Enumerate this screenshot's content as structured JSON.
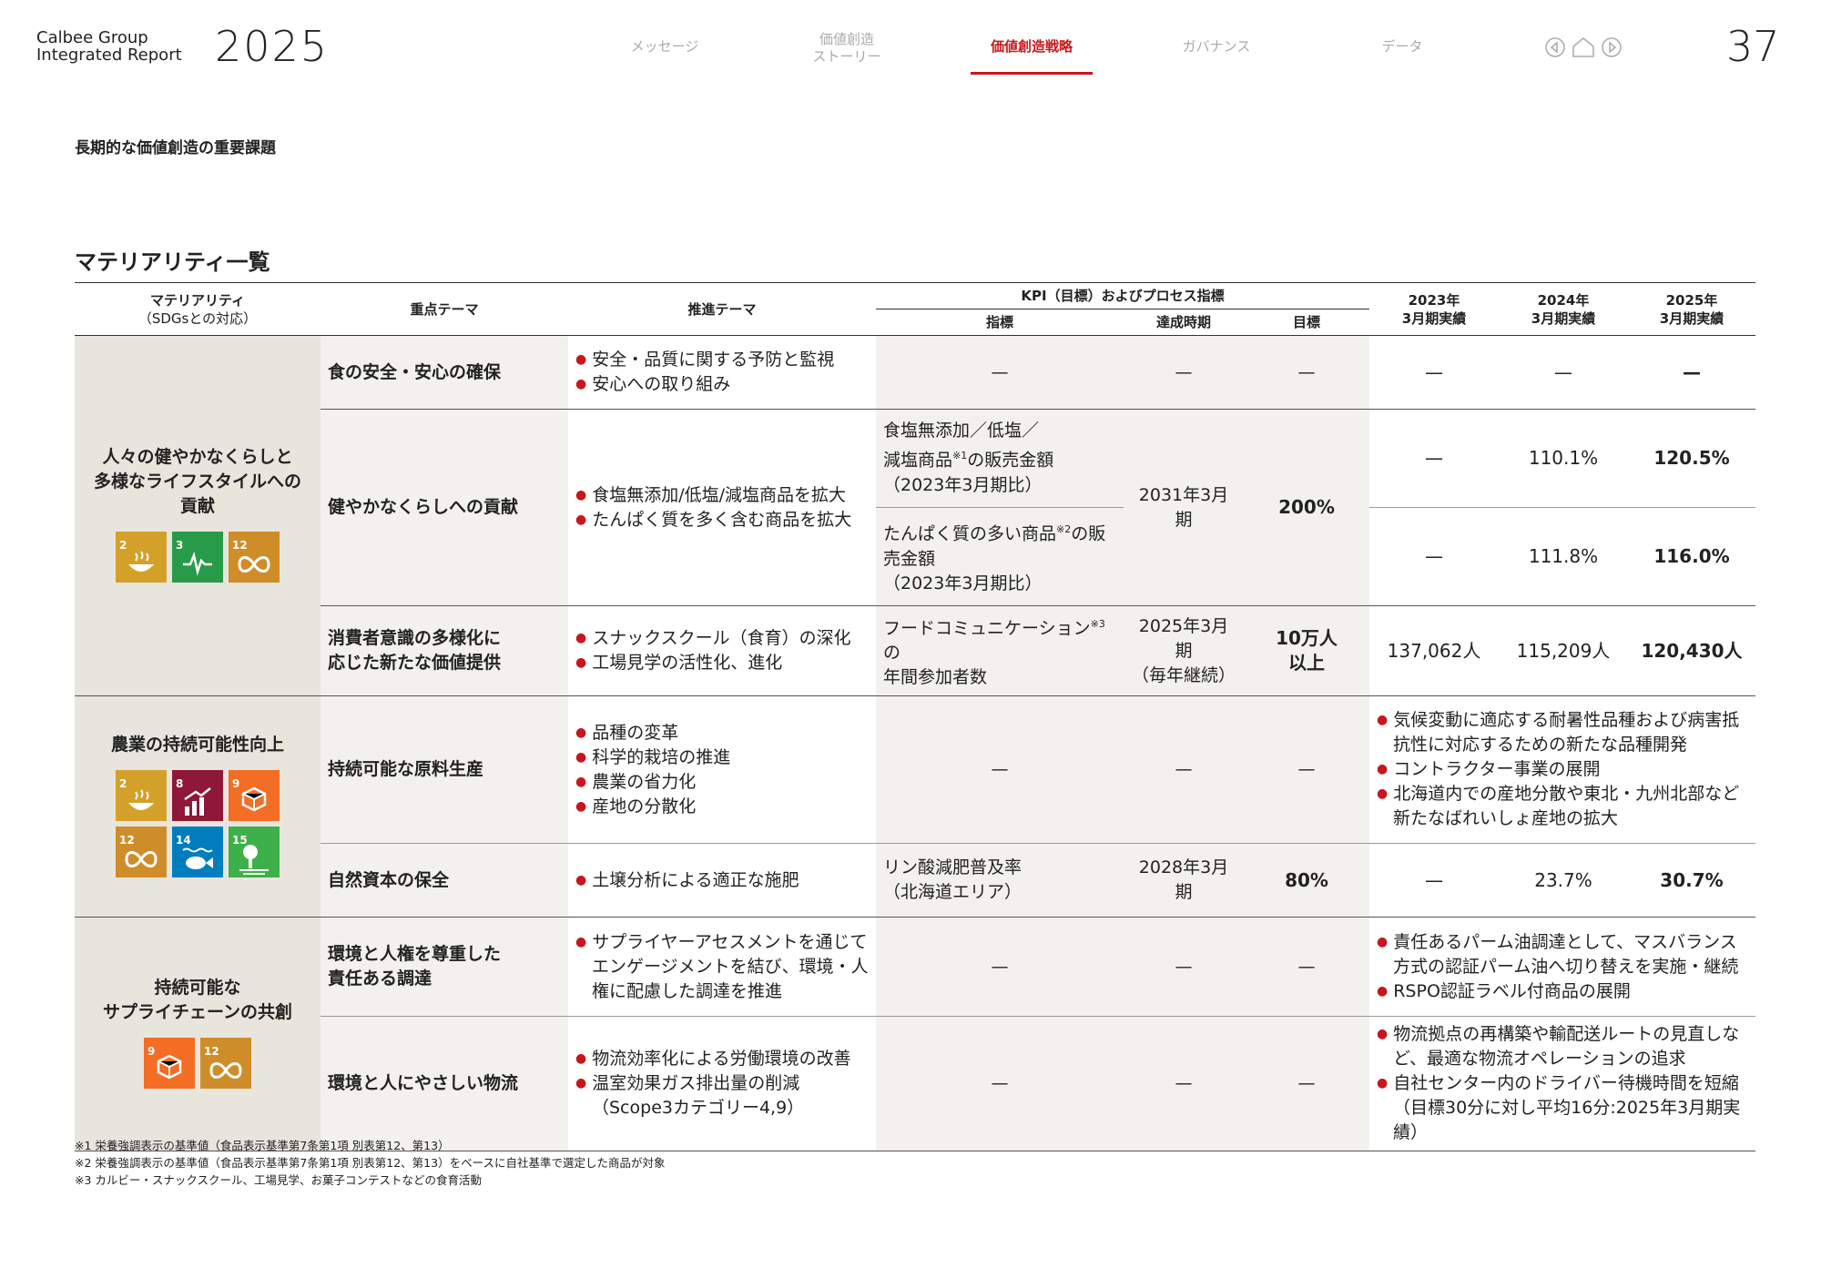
{
  "header": {
    "brand_line1": "Calbee Group",
    "brand_line2": "Integrated Report",
    "year": "2025",
    "page_number": "37",
    "nav": [
      {
        "label": "メッセージ"
      },
      {
        "label1": "価値創造",
        "label2": "ストーリー"
      },
      {
        "label": "価値創造戦略"
      },
      {
        "label": "ガバナンス"
      },
      {
        "label": "データ"
      }
    ],
    "accent_color": "#c8161d"
  },
  "section_title": "長期的な価値創造の重要課題",
  "table_title": "マテリアリティ一覧",
  "table": {
    "headers": {
      "materiality": "マテリアリティ",
      "materiality_sub": "（SDGsとの対応）",
      "focus_theme": "重点テーマ",
      "promotion_theme": "推進テーマ",
      "kpi_group": "KPI（目標）およびプロセス指標",
      "indicator": "指標",
      "deadline": "達成時期",
      "target": "目標",
      "fy2023_1": "2023年",
      "fy2023_2": "3月期実績",
      "fy2024_1": "2024年",
      "fy2024_2": "3月期実績",
      "fy2025_1": "2025年",
      "fy2025_2": "3月期実績"
    },
    "groups": [
      {
        "materiality_lines": [
          "人々の健やかなくらしと",
          "多様なライフスタイルへの",
          "貢献"
        ],
        "sdgs": [
          {
            "num": "2",
            "color": "#d3a029",
            "icon": "bowl-icon"
          },
          {
            "num": "3",
            "color": "#279b48",
            "icon": "heartbeat-icon"
          },
          {
            "num": "12",
            "color": "#cf8d2a",
            "icon": "infinity-icon"
          }
        ]
      },
      {
        "materiality_lines": [
          "農業の持続可能性向上"
        ],
        "sdgs": [
          {
            "num": "2",
            "color": "#d3a029",
            "icon": "bowl-icon"
          },
          {
            "num": "8",
            "color": "#8f1838",
            "icon": "growth-chart-icon"
          },
          {
            "num": "9",
            "color": "#f36d25",
            "icon": "cubes-icon"
          },
          {
            "num": "12",
            "color": "#cf8d2a",
            "icon": "infinity-icon"
          },
          {
            "num": "14",
            "color": "#007dbc",
            "icon": "fish-icon"
          },
          {
            "num": "15",
            "color": "#3eb049",
            "icon": "tree-icon"
          }
        ]
      },
      {
        "materiality_lines": [
          "持続可能な",
          "サプライチェーンの共創"
        ],
        "sdgs": [
          {
            "num": "9",
            "color": "#f36d25",
            "icon": "cubes-icon"
          },
          {
            "num": "12",
            "color": "#cf8d2a",
            "icon": "infinity-icon"
          }
        ]
      }
    ],
    "rows": {
      "r1": {
        "theme": "食の安全・安心の確保",
        "promo": [
          "安全・品質に関する予防と監視",
          "安心への取り組み"
        ],
        "indicator": "—",
        "deadline": "—",
        "target": "—",
        "fy2023": "—",
        "fy2024": "—",
        "fy2025": "—"
      },
      "r2": {
        "theme": "健やかなくらしへの貢献",
        "promo": [
          "食塩無添加/低塩/減塩商品を拡大",
          "たんぱく質を多く含む商品を拡大"
        ],
        "indicator_a_1": "食塩無添加／低塩／",
        "indicator_a_2": "減塩商品",
        "indicator_a_sup": "※1",
        "indicator_a_3": "の販売金額",
        "indicator_a_4": "（2023年3月期比）",
        "indicator_b_1": "たんぱく質の多い商品",
        "indicator_b_sup": "※2",
        "indicator_b_2": "の販",
        "indicator_b_3": "売金額",
        "indicator_b_4": "（2023年3月期比）",
        "deadline": "2031年3月期",
        "target": "200%",
        "a_fy2023": "—",
        "a_fy2024": "110.1%",
        "a_fy2025": "120.5%",
        "b_fy2023": "—",
        "b_fy2024": "111.8%",
        "b_fy2025": "116.0%"
      },
      "r3": {
        "theme_1": "消費者意識の多様化に",
        "theme_2": "応じた新たな価値提供",
        "promo": [
          "スナックスクール（食育）の深化",
          "工場見学の活性化、進化"
        ],
        "indicator_1": "フードコミュニケーション",
        "indicator_sup": "※3",
        "indicator_2": "の",
        "indicator_3": "年間参加者数",
        "deadline_1": "2025年3月期",
        "deadline_2": "（毎年継続）",
        "target_1": "10万人",
        "target_2": "以上",
        "fy2023": "137,062人",
        "fy2024": "115,209人",
        "fy2025": "120,430人"
      },
      "r4": {
        "theme": "持続可能な原料生産",
        "promo": [
          "品種の変革",
          "科学的栽培の推進",
          "農業の省力化",
          "産地の分散化"
        ],
        "indicator": "—",
        "deadline": "—",
        "target": "—",
        "results": [
          "気候変動に適応する耐暑性品種および病害抵抗性に対応するための新たな品種開発",
          "コントラクター事業の展開",
          "北海道内での産地分散や東北・九州北部など新たなばれいしょ産地の拡大"
        ]
      },
      "r5": {
        "theme": "自然資本の保全",
        "promo": [
          "土壌分析による適正な施肥"
        ],
        "indicator_1": "リン酸減肥普及率",
        "indicator_2": "（北海道エリア）",
        "deadline": "2028年3月期",
        "target": "80%",
        "fy2023": "—",
        "fy2024": "23.7%",
        "fy2025": "30.7%"
      },
      "r6": {
        "theme_1": "環境と人権を尊重した",
        "theme_2": "責任ある調達",
        "promo": [
          "サプライヤーアセスメントを通じてエンゲージメントを結び、環境・人権に配慮した調達を推進"
        ],
        "indicator": "—",
        "deadline": "—",
        "target": "—",
        "results": [
          "責任あるパーム油調達として、マスバランス方式の認証パーム油へ切り替えを実施・継続",
          "RSPO認証ラベル付商品の展開"
        ]
      },
      "r7": {
        "theme": "環境と人にやさしい物流",
        "promo": [
          "物流効率化による労働環境の改善",
          "温室効果ガス排出量の削減（Scope3カテゴリー4,9）"
        ],
        "indicator": "—",
        "deadline": "—",
        "target": "—",
        "results": [
          "物流拠点の再構築や輸配送ルートの見直しなど、最適な物流オペレーションの追求",
          "自社センター内のドライバー待機時間を短縮（目標30分に対し平均16分:2025年3月期実績）"
        ]
      }
    }
  },
  "footnotes": [
    "※1 栄養強調表示の基準値（食品表示基準第7条第1項 別表第12、第13）",
    "※2 栄養強調表示の基準値（食品表示基準第7条第1項 別表第12、第13）をベースに自社基準で選定した商品が対象",
    "※3 カルビー・スナックスクール、工場見学、お菓子コンテストなどの食育活動"
  ]
}
